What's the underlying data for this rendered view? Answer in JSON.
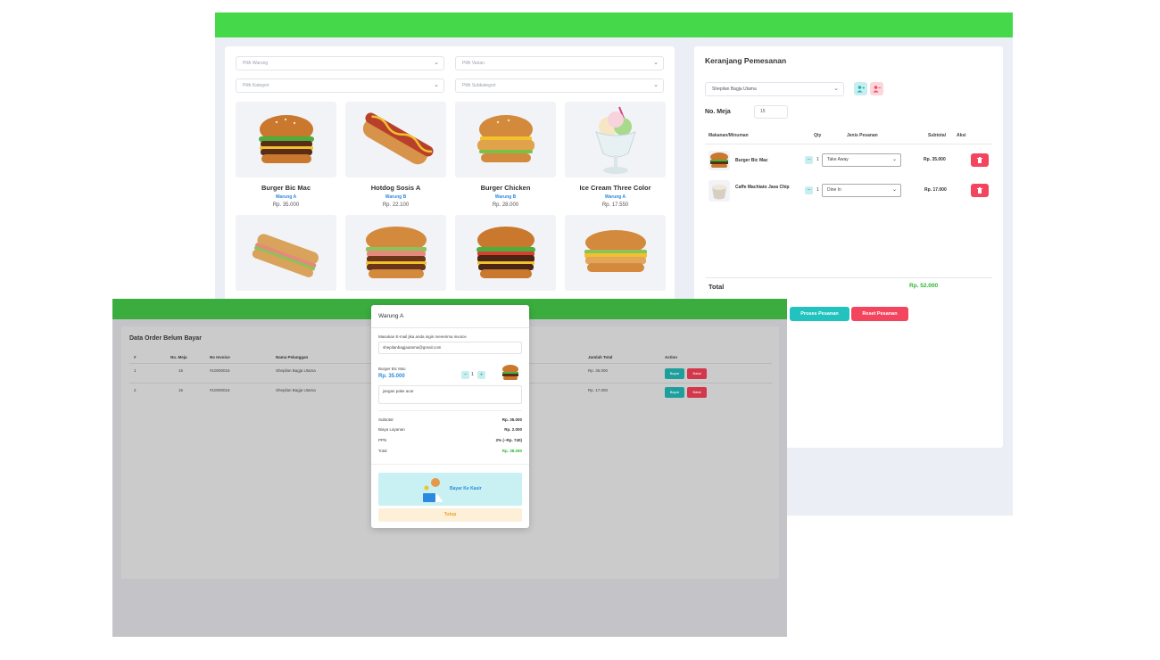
{
  "pos": {
    "filters": {
      "warung_placeholder": "Pilih Warung",
      "varian_placeholder": "Pilih Varian",
      "kategori_placeholder": "Pilih Kategori",
      "subkategori_placeholder": "Pilih Subkategori"
    },
    "products": [
      {
        "name": "Burger Bic Mac",
        "warung": "Warung A",
        "price": "Rp. 35.000",
        "icon": "burger"
      },
      {
        "name": "Hotdog Sosis A",
        "warung": "Warung B",
        "price": "Rp. 22.100",
        "icon": "hotdog"
      },
      {
        "name": "Burger Chicken",
        "warung": "Warung B",
        "price": "Rp. 28.000",
        "icon": "chicken-burger"
      },
      {
        "name": "Ice Cream Three Color",
        "warung": "Warung A",
        "price": "Rp. 17.550",
        "icon": "ice-cream"
      },
      {
        "icon": "sub-sandwich"
      },
      {
        "icon": "double-burger"
      },
      {
        "icon": "beef-burger"
      },
      {
        "icon": "cheese-burger"
      }
    ]
  },
  "cart": {
    "title": "Keranjang Pemesanan",
    "customer_value": "Shepilan Bagja Utama",
    "table_label": "No. Meja",
    "table_value": "15",
    "headers": {
      "item": "Makanan/Minuman",
      "qty": "Qty",
      "type": "Jenis Pesanan",
      "subtotal": "Subtotal",
      "action": "Aksi"
    },
    "items": [
      {
        "name": "Burger Bic Mac",
        "qty": "1",
        "type": "Take Away",
        "subtotal": "Rp. 35.000"
      },
      {
        "name": "Caffe Machiato Java Chip",
        "qty": "1",
        "type": "Dine In",
        "subtotal": "Rp. 17.000"
      }
    ],
    "total_label": "Total",
    "total_value": "Rp. 52.000",
    "process_label": "Proses Pesanan",
    "reset_label": "Reset Pesanan"
  },
  "orders": {
    "title": "Data Order Belum Bayar",
    "headers": {
      "num": "#",
      "meja": "No. Meja",
      "invoice": "No Invoice",
      "nama": "Nama Pelanggan",
      "jumlah": "Jumlah Total",
      "action": "Action"
    },
    "rows": [
      {
        "num": "1",
        "meja": "15",
        "invoice": "#10000015",
        "nama": "Shepilan Bagja Utama",
        "jumlah": "Rp. 35.000"
      },
      {
        "num": "2",
        "meja": "15",
        "invoice": "#10000016",
        "nama": "Shepilan Bagja Utama",
        "jumlah": "Rp. 17.000"
      }
    ],
    "pay_label": "Bayar",
    "cancel_label": "Batal"
  },
  "modal": {
    "title": "Warung A",
    "email_prompt": "Masukan E-mail jika anda ingin menerima invoice",
    "email_value": "shepilanbagjautama@gmail.com",
    "item_name": "Burger Bic Mac",
    "item_price": "Rp. 35.000",
    "item_qty": "1",
    "note": "jangan pake acar",
    "subtotal_label": "Subtotal",
    "subtotal_value": "Rp. 35.000",
    "service_label": "Biaya Layanan",
    "service_value": "Rp. 2.000",
    "ppn_label": "PPN",
    "ppn_value": "2% (~Rp. 740)",
    "total_label": "Total",
    "total_value": "Rp. 38.260",
    "pay_cashier_label": "Bayar Ke Kasir",
    "close_label": "Tutup"
  },
  "colors": {
    "topbar": "#46d84b",
    "accent_teal": "#22c3bf",
    "danger": "#f3455e",
    "link_blue": "#2b8ae0",
    "total_green": "#2fb52f"
  }
}
